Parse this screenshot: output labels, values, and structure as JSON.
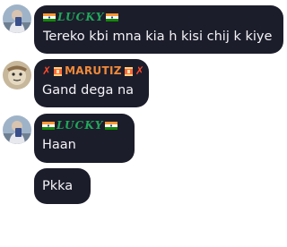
{
  "messages": [
    {
      "author": "LUCKY",
      "text": "Tereko kbi mna kia h kisi chij k kiye"
    },
    {
      "author": "MARUTIZ",
      "text": "Gand dega na"
    },
    {
      "author": "LUCKY",
      "text": "Haan"
    },
    {
      "text": "Pkka"
    }
  ],
  "colors": {
    "bubble": "#1c1d2b",
    "text": "#f3f3f6",
    "lucky_name": "#20a85a",
    "marutiz_name": "#f08a3a",
    "decor_x": "#ff4a2a"
  }
}
